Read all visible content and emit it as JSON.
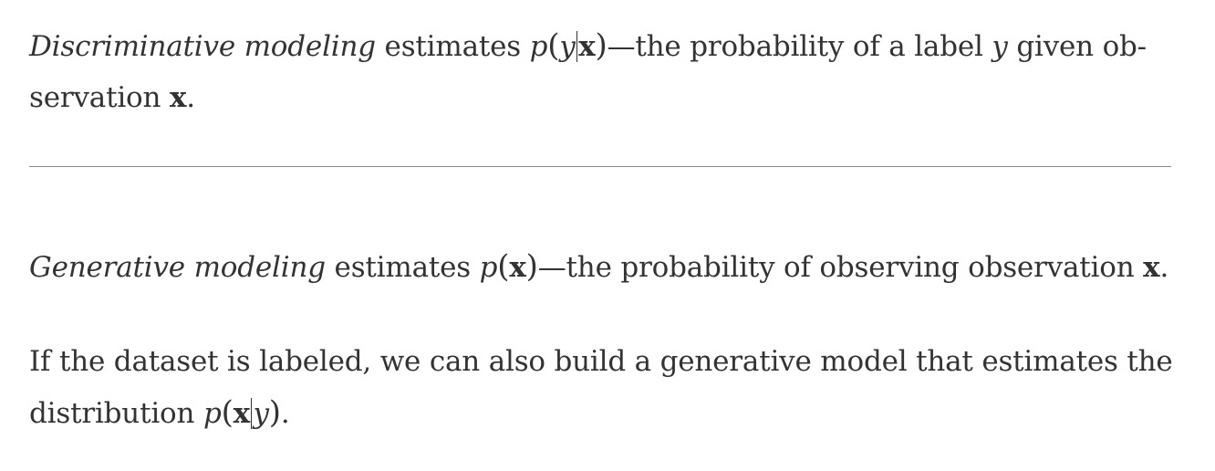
{
  "para1": {
    "term": "Discriminative modeling",
    "text_a": " estimates ",
    "math_p": "p",
    "math_open": "(",
    "math_y": "y",
    "math_x": "x",
    "math_close": ")",
    "text_b": "—the probability of a label ",
    "var_y": "y",
    "text_c": " given ob-",
    "text_d": "servation ",
    "var_x": "x",
    "text_e": "."
  },
  "para2": {
    "term": "Generative modeling",
    "text_a": " estimates ",
    "math_p": "p",
    "math_open": "(",
    "math_x": "x",
    "math_close": ")",
    "text_b": "—the probability of observing observation ",
    "var_x": "x",
    "text_c": "."
  },
  "para3": {
    "text_a": "If the dataset is labeled, we can also build a generative model that estimates the",
    "text_b": "distribution ",
    "math_p": "p",
    "math_open": "(",
    "math_x": "x",
    "math_y": "y",
    "math_close": ")",
    "text_c": "."
  }
}
